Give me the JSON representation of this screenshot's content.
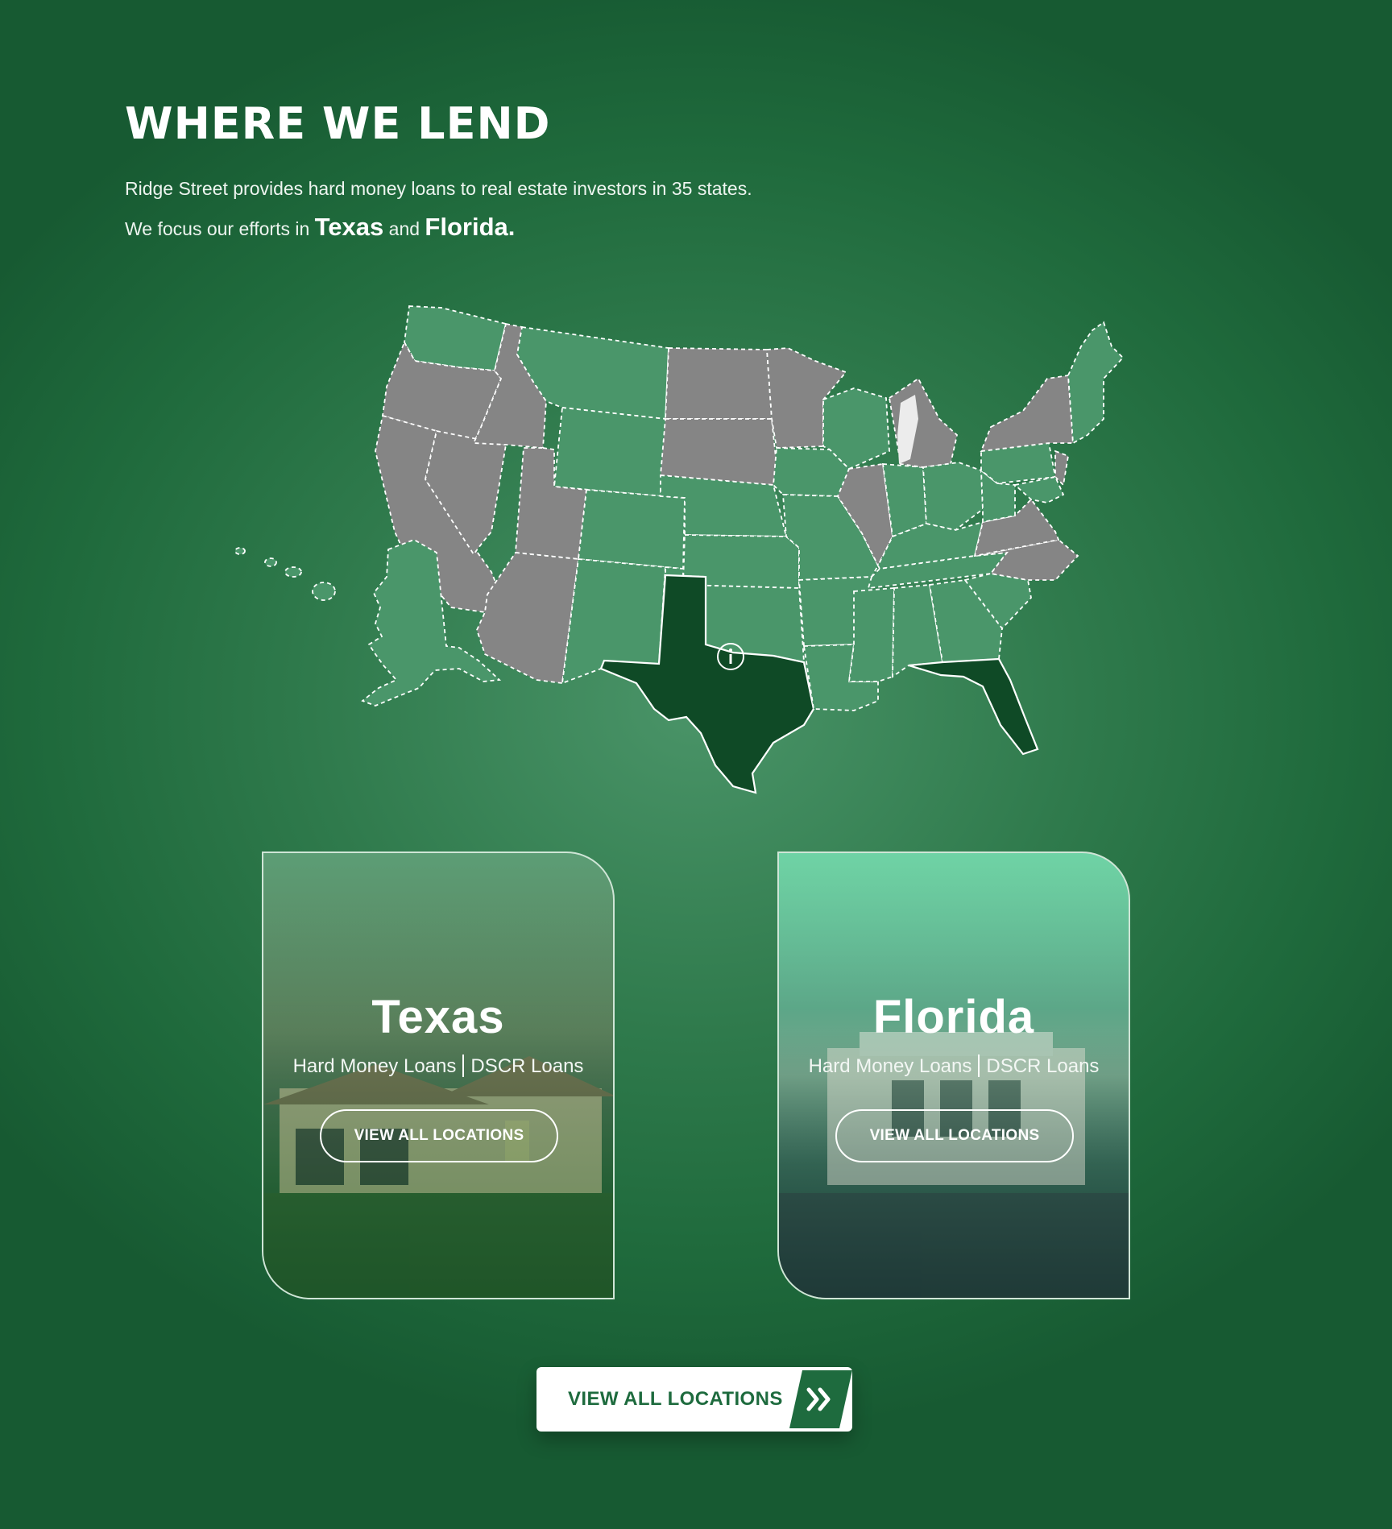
{
  "section": {
    "title": "WHERE WE LEND",
    "intro_line1": "Ridge Street provides hard money loans to real estate investors in 35 states.",
    "intro_line2_prefix": "We focus our efforts in",
    "intro_state1": "Texas",
    "intro_and": "and",
    "intro_state2": "Florida",
    "intro_end": "."
  },
  "map": {
    "colors": {
      "lending": "#4a966a",
      "not_lending": "#858585",
      "focus": "#0f4a26"
    },
    "info_icon": "info-icon"
  },
  "cards": [
    {
      "state": "Texas",
      "loan_type_1": "Hard Money Loans",
      "loan_type_2": "DSCR Loans",
      "button": "VIEW ALL LOCATIONS"
    },
    {
      "state": "Florida",
      "loan_type_1": "Hard Money Loans",
      "loan_type_2": "DSCR Loans",
      "button": "VIEW ALL LOCATIONS"
    }
  ],
  "cta": {
    "label": "VIEW ALL LOCATIONS",
    "icon": "double-chevron-right-icon",
    "accent": "#1e6b3e"
  }
}
